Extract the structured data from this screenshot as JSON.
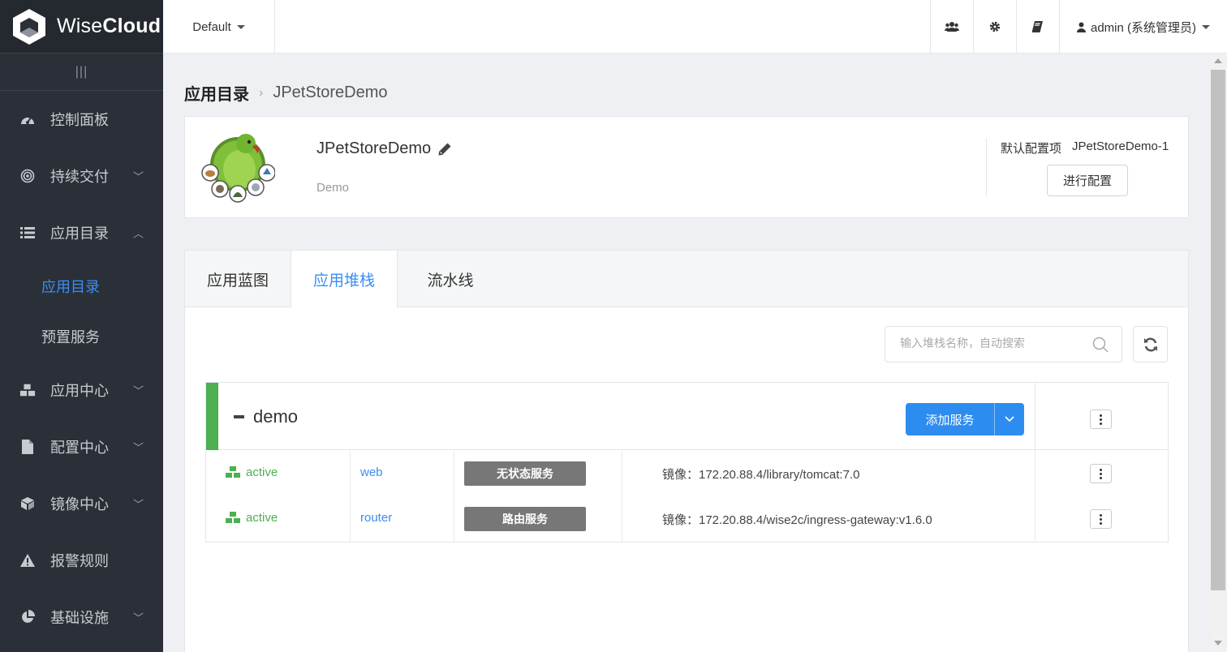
{
  "brand": {
    "name_regular": "Wise",
    "name_bold": "Cloud"
  },
  "sidebar": {
    "collapse_glyph": "|||",
    "items": [
      {
        "label": "控制面板",
        "icon": "dashboard-icon",
        "has_chevron": false
      },
      {
        "label": "持续交付",
        "icon": "target-icon",
        "has_chevron": true,
        "chevron": "﹀"
      },
      {
        "label": "应用目录",
        "icon": "list-icon",
        "has_chevron": true,
        "chevron": "︿",
        "expanded": true
      },
      {
        "label": "应用中心",
        "icon": "cubes-icon",
        "has_chevron": true,
        "chevron": "﹀"
      },
      {
        "label": "配置中心",
        "icon": "file-icon",
        "has_chevron": true,
        "chevron": "﹀"
      },
      {
        "label": "镜像中心",
        "icon": "cube-icon",
        "has_chevron": true,
        "chevron": "﹀"
      },
      {
        "label": "报警规则",
        "icon": "warning-icon",
        "has_chevron": false
      },
      {
        "label": "基础设施",
        "icon": "pie-chart-icon",
        "has_chevron": true,
        "chevron": "﹀"
      }
    ],
    "sub_items": [
      {
        "label": "应用目录",
        "active": true
      },
      {
        "label": "预置服务",
        "active": false
      }
    ]
  },
  "topbar": {
    "workspace": "Default",
    "icons": [
      "users-icon",
      "gear-icon",
      "book-icon"
    ],
    "user": "admin (系统管理员)"
  },
  "breadcrumb": {
    "root": "应用目录",
    "separator": "›",
    "current": "JPetStoreDemo"
  },
  "app": {
    "name": "JPetStoreDemo",
    "description": "Demo",
    "config_label": "默认配置项",
    "config_value": "JPetStoreDemo-1",
    "config_button": "进行配置"
  },
  "tabs": [
    {
      "label": "应用蓝图",
      "active": false
    },
    {
      "label": "应用堆栈",
      "active": true
    },
    {
      "label": "流水线",
      "active": false
    }
  ],
  "search": {
    "placeholder": "输入堆栈名称，自动搜索",
    "value": ""
  },
  "stack": {
    "name": "demo",
    "add_button": "添加服务",
    "services": [
      {
        "status": "active",
        "name": "web",
        "type": "无状态服务",
        "image": "镜像：172.20.88.4/library/tomcat:7.0"
      },
      {
        "status": "active",
        "name": "router",
        "type": "路由服务",
        "image": "镜像：172.20.88.4/wise2c/ingress-gateway:v1.6.0"
      }
    ]
  },
  "colors": {
    "sidebar_bg": "#2b3038",
    "accent_blue": "#3b8ef3",
    "primary_button": "#2d8cf0",
    "stack_bar": "#4caf50",
    "status_green": "#4caf50",
    "type_badge": "#777777"
  }
}
